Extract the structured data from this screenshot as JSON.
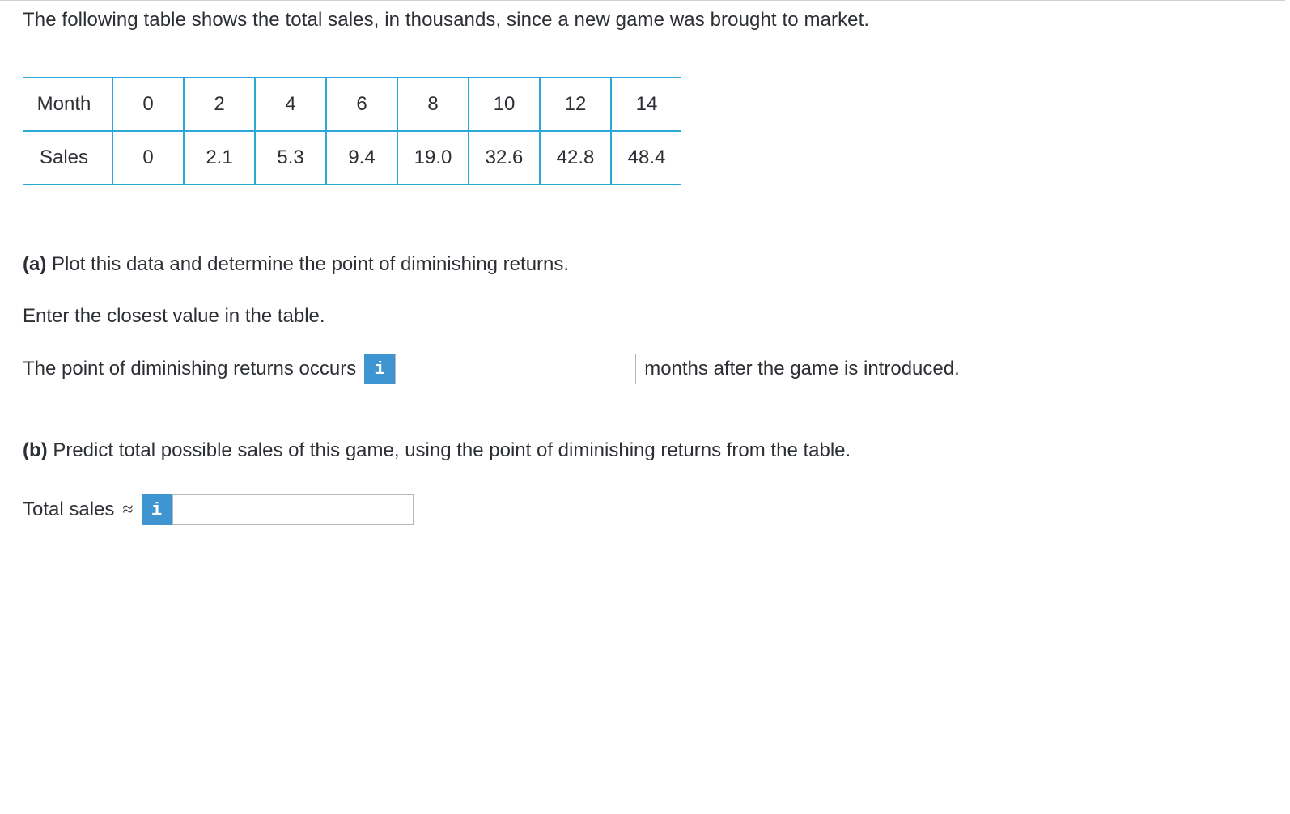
{
  "intro": "The following table shows the total sales, in thousands, since a new game was brought to market.",
  "chart_data": {
    "type": "table",
    "rows": [
      {
        "label": "Month",
        "values": [
          "0",
          "2",
          "4",
          "6",
          "8",
          "10",
          "12",
          "14"
        ]
      },
      {
        "label": "Sales",
        "values": [
          "0",
          "2.1",
          "5.3",
          "9.4",
          "19.0",
          "32.6",
          "42.8",
          "48.4"
        ]
      }
    ]
  },
  "partA": {
    "label": "(a)",
    "text": " Plot this data and determine the point of diminishing returns.",
    "hint": "Enter the closest value in the table.",
    "lead": "The point of diminishing returns occurs",
    "trail": "months after the game is introduced."
  },
  "partB": {
    "label": "(b)",
    "text": " Predict total possible sales of this game, using the point of diminishing returns from the table.",
    "lead": "Total sales",
    "approx": "≈"
  },
  "info_glyph": "i"
}
